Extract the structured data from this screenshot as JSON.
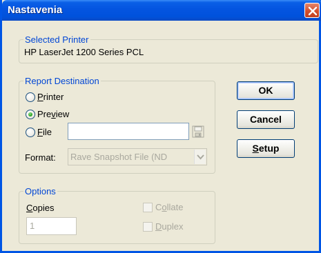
{
  "window": {
    "title": "Nastavenia"
  },
  "selected_printer": {
    "legend": "Selected Printer",
    "printer_name": "HP LaserJet 1200 Series PCL"
  },
  "report_destination": {
    "legend": "Report Destination",
    "options": [
      {
        "pre": "",
        "accel": "P",
        "post": "rinter",
        "selected": false
      },
      {
        "pre": "Pre",
        "accel": "v",
        "post": "iew",
        "selected": true
      },
      {
        "pre": "",
        "accel": "F",
        "post": "ile",
        "selected": false
      }
    ],
    "file_value": "",
    "format_label": "Format:",
    "format_value": "Rave Snapshot File (ND"
  },
  "options": {
    "legend": "Options",
    "copies_pre": "",
    "copies_accel": "C",
    "copies_post": "opies",
    "copies_value": "1",
    "collate_pre": "C",
    "collate_accel": "o",
    "collate_post": "llate",
    "duplex_pre": "",
    "duplex_accel": "D",
    "duplex_post": "uplex"
  },
  "buttons": {
    "ok": "OK",
    "cancel": "Cancel",
    "setup_accel": "S",
    "setup_post": "etup"
  }
}
